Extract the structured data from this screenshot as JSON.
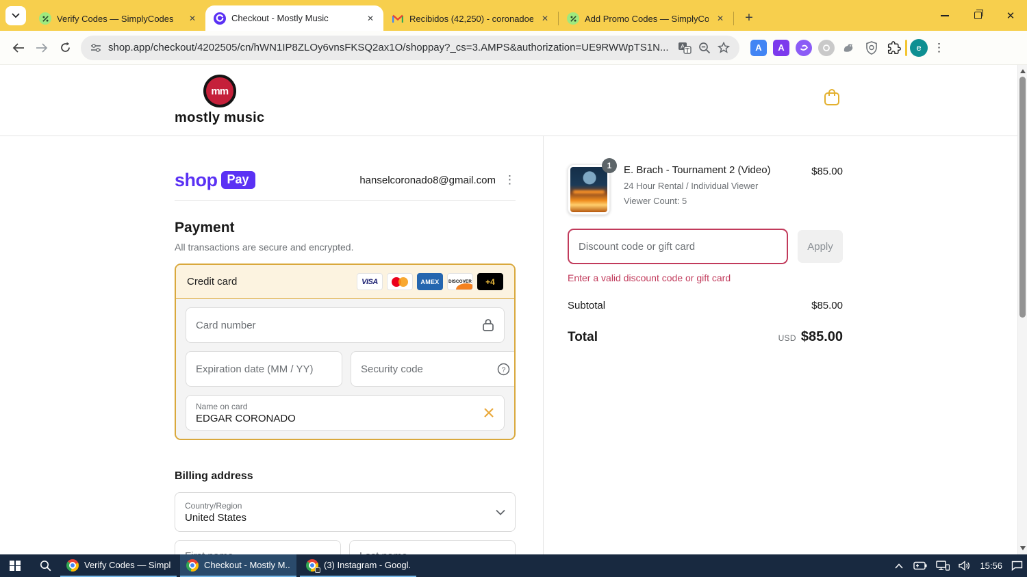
{
  "browser": {
    "tabs": [
      {
        "title": "Verify Codes — SimplyCodes"
      },
      {
        "title": "Checkout - Mostly Music"
      },
      {
        "title": "Recibidos (42,250) - coronadoe"
      },
      {
        "title": "Add Promo Codes — SimplyCo"
      }
    ],
    "url": "shop.app/checkout/4202505/cn/hWN1IP8ZLOy6vnsFKSQ2ax1O/shoppay?_cs=3.AMPS&authorization=UE9RWWpTS1N...",
    "profile_initial": "e"
  },
  "shop_header": {
    "logo_monogram": "mm",
    "brand": "mostly music"
  },
  "checkout": {
    "shop_pay": {
      "shop": "shop",
      "pay": "Pay"
    },
    "email": "hanselcoronado8@gmail.com",
    "payment": {
      "heading": "Payment",
      "subheading": "All transactions are secure and encrypted.",
      "method": "Credit card",
      "badge_visa": "VISA",
      "badge_amex": "AMEX",
      "badge_discover": "DISCOVER",
      "badge_more": "+4",
      "card_number_placeholder": "Card number",
      "expiration_placeholder": "Expiration date (MM / YY)",
      "security_placeholder": "Security code",
      "name_label": "Name on card",
      "name_value": "EDGAR CORONADO"
    },
    "billing": {
      "heading": "Billing address",
      "country_label": "Country/Region",
      "country_value": "United States",
      "first_name_placeholder": "First name",
      "last_name_placeholder": "Last name"
    }
  },
  "order_summary": {
    "item": {
      "quantity": "1",
      "title": "E. Brach - Tournament 2 (Video)",
      "variant": "24 Hour Rental / Individual Viewer",
      "viewer_count": "Viewer Count: 5",
      "price": "$85.00"
    },
    "discount": {
      "placeholder": "Discount code or gift card",
      "apply_label": "Apply",
      "error": "Enter a valid discount code or gift card"
    },
    "subtotal_label": "Subtotal",
    "subtotal_value": "$85.00",
    "total_label": "Total",
    "currency": "USD",
    "total_value": "$85.00"
  },
  "taskbar": {
    "buttons": [
      {
        "label": "Verify Codes — Simpl..."
      },
      {
        "label": "Checkout - Mostly M..."
      },
      {
        "label": "(3) Instagram - Googl..."
      }
    ],
    "time": "15:56"
  },
  "colors": {
    "theme_yellow": "#f7cf4d",
    "shop_purple": "#5a31f4",
    "gold_border": "#d9a83c",
    "error_red": "#c13a5b",
    "brand_red": "#c5203a",
    "taskbar_navy": "#182940"
  }
}
